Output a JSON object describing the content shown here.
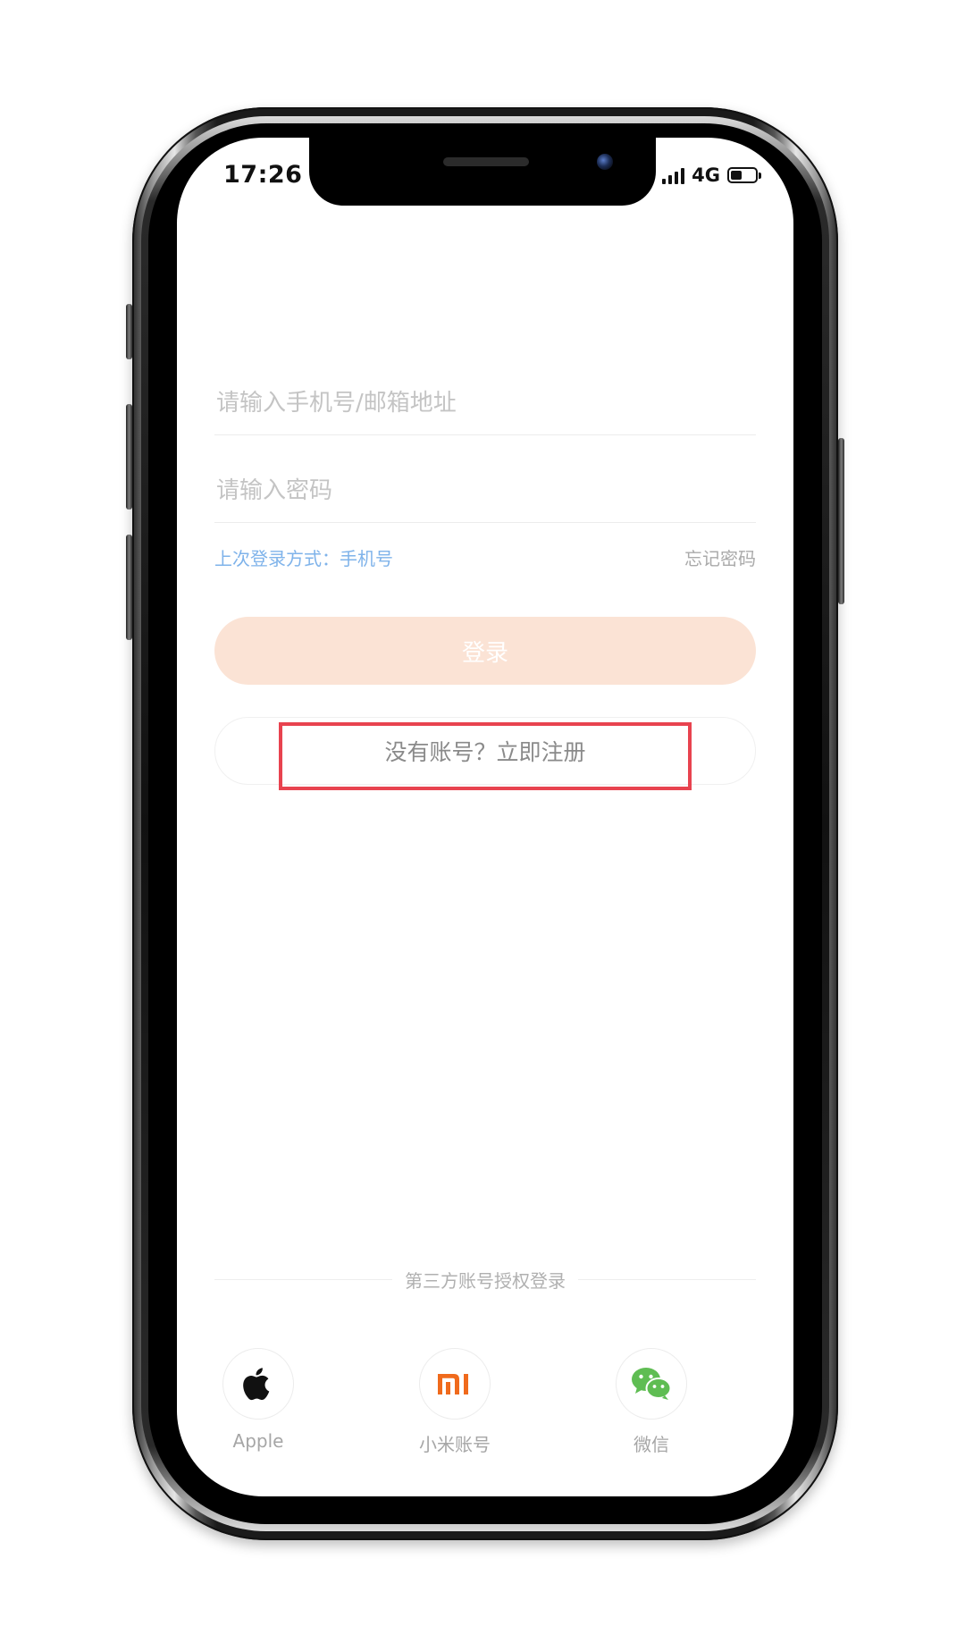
{
  "status_bar": {
    "time": "17:26",
    "network": "4G",
    "battery_level": 0.45
  },
  "login_form": {
    "account_placeholder": "请输入手机号/邮箱地址",
    "account_value": "",
    "password_placeholder": "请输入密码",
    "password_value": "",
    "last_login_text": "上次登录方式：手机号",
    "forgot_password": "忘记密码",
    "login_button": "登录",
    "register_button": "没有账号？立即注册"
  },
  "third_party": {
    "title": "第三方账号授权登录",
    "providers": [
      {
        "label": "Apple",
        "icon": "apple-icon"
      },
      {
        "label": "小米账号",
        "icon": "xiaomi-icon",
        "icon_text": "mi"
      },
      {
        "label": "微信",
        "icon": "wechat-icon"
      }
    ]
  },
  "colors": {
    "link_blue": "#7fb3ea",
    "login_button_bg": "#fbe3d5",
    "xiaomi_orange": "#f06a1c",
    "wechat_green": "#5fbd53",
    "highlight_red": "#e8434f"
  }
}
